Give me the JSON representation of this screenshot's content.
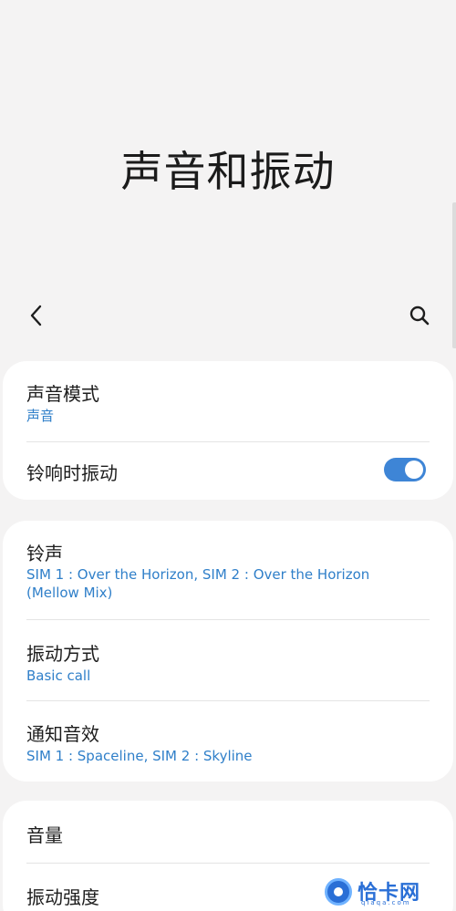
{
  "page": {
    "title": "声音和振动"
  },
  "toolbar": {
    "back_icon": "chevron-left-icon",
    "search_icon": "search-icon"
  },
  "group1": {
    "sound_mode": {
      "label": "声音模式",
      "value": "声音"
    },
    "vibrate_on_ring": {
      "label": "铃响时振动",
      "enabled": true
    }
  },
  "group2": {
    "ringtone": {
      "label": "铃声",
      "value": "SIM 1 : Over the Horizon, SIM 2 : Over the Horizon (Mellow Mix)"
    },
    "vibration_pattern": {
      "label": "振动方式",
      "value": "Basic call"
    },
    "notification_sound": {
      "label": "通知音效",
      "value": "SIM 1 : Spaceline, SIM 2 : Skyline"
    }
  },
  "group3": {
    "volume": {
      "label": "音量"
    },
    "vibration_intensity": {
      "label": "振动强度"
    }
  },
  "watermark": {
    "brand": "恰卡网",
    "domain": "qiaqa.com"
  },
  "colors": {
    "accent": "#2f7fc9",
    "toggle_on": "#3e85d6",
    "background": "#f4f3f3",
    "card": "#ffffff"
  }
}
